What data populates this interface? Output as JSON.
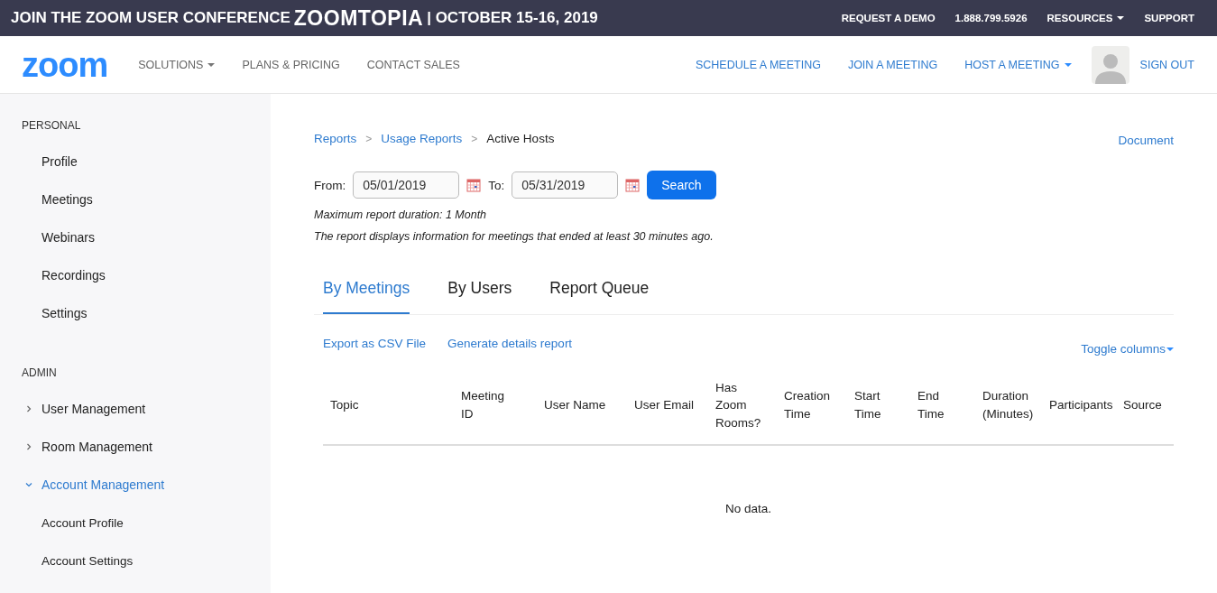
{
  "promo_bar": {
    "text": "JOIN THE ZOOM USER CONFERENCE",
    "brand": "ZOOMTOPIA",
    "date": "| OCTOBER 15-16, 2019",
    "links": [
      {
        "label": "REQUEST A DEMO",
        "dropdown": false
      },
      {
        "label": "1.888.799.5926",
        "dropdown": false
      },
      {
        "label": "RESOURCES",
        "dropdown": true
      },
      {
        "label": "SUPPORT",
        "dropdown": false
      }
    ]
  },
  "nav": {
    "logo": "zoom",
    "left": [
      {
        "label": "SOLUTIONS",
        "dropdown": true
      },
      {
        "label": "PLANS & PRICING",
        "dropdown": false
      },
      {
        "label": "CONTACT SALES",
        "dropdown": false
      }
    ],
    "right": [
      {
        "label": "SCHEDULE A MEETING",
        "dropdown": false
      },
      {
        "label": "JOIN A MEETING",
        "dropdown": false
      },
      {
        "label": "HOST A MEETING",
        "dropdown": true
      }
    ],
    "sign_out": "SIGN OUT"
  },
  "sidebar": {
    "sections": [
      {
        "title": "PERSONAL",
        "items": [
          {
            "label": "Profile",
            "selected": false
          },
          {
            "label": "Meetings",
            "selected": false
          },
          {
            "label": "Webinars",
            "selected": false
          },
          {
            "label": "Recordings",
            "selected": false
          },
          {
            "label": "Settings",
            "selected": false
          }
        ]
      },
      {
        "title": "ADMIN",
        "items": [
          {
            "label": "User Management",
            "expanded": false,
            "selected": false
          },
          {
            "label": "Room Management",
            "expanded": false,
            "selected": false
          },
          {
            "label": "Account Management",
            "expanded": true,
            "selected": true,
            "children": [
              {
                "label": "Account Profile",
                "selected": false
              },
              {
                "label": "Account Settings",
                "selected": false
              }
            ]
          }
        ]
      }
    ]
  },
  "breadcrumb": [
    "Reports",
    "Usage Reports",
    "Active Hosts"
  ],
  "breadcrumb_separators": [
    ">",
    ">"
  ],
  "document_link": "Document",
  "filter": {
    "from_label": "From:",
    "from": "05/01/2019",
    "to_label": "To:",
    "to": "05/31/2019",
    "button": "Search"
  },
  "notes": [
    "Maximum report duration: 1 Month",
    "The report displays information for meetings that ended at least 30 minutes ago."
  ],
  "tabs": [
    {
      "label": "By Meetings",
      "selected": true
    },
    {
      "label": "By Users",
      "selected": false
    },
    {
      "label": "Report Queue",
      "selected": false
    }
  ],
  "actions": [
    "Export as CSV File",
    "Generate details report"
  ],
  "toggle_columns": "Toggle columns",
  "table": {
    "columns": [
      "Topic",
      "Meeting ID",
      "User Name",
      "User Email",
      "Has Zoom Rooms?",
      "Creation Time",
      "Start Time",
      "End Time",
      "Duration (Minutes)",
      "Participants",
      "Source"
    ],
    "empty": "No data."
  }
}
